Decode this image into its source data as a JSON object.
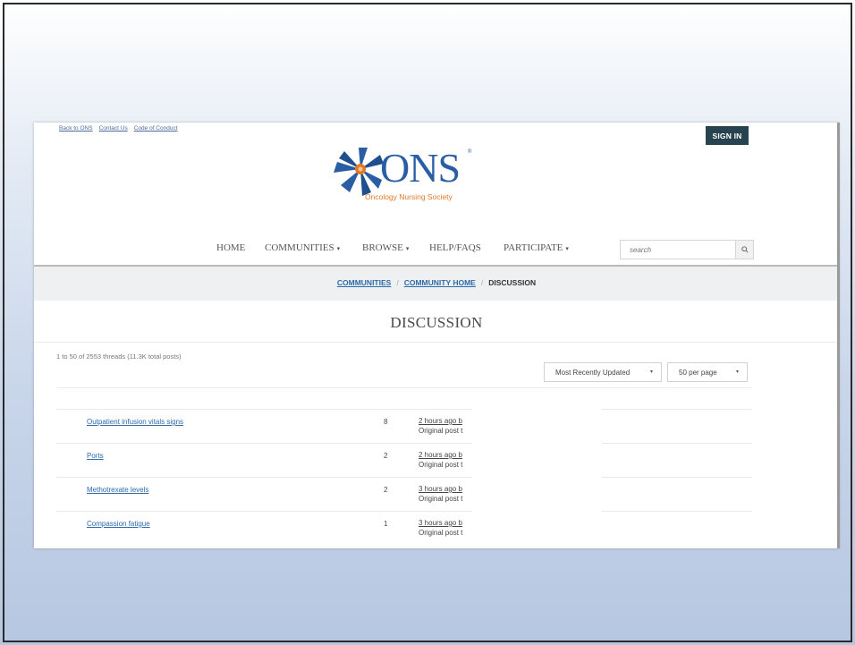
{
  "header": {
    "utility_links": [
      "Back to ONS",
      "Contact Us",
      "Code of Conduct"
    ],
    "sign_in_label": "SIGN IN"
  },
  "logo": {
    "name": "ONS",
    "registered": "®",
    "subtitle": "Oncology Nursing Society",
    "colors": {
      "primary": "#2a5ea4",
      "accent": "#e07a27"
    }
  },
  "nav": {
    "items": [
      {
        "label": "HOME",
        "has_dropdown": false
      },
      {
        "label": "COMMUNITIES",
        "has_dropdown": true
      },
      {
        "label": "BROWSE",
        "has_dropdown": true
      },
      {
        "label": "HELP/FAQS",
        "has_dropdown": false
      },
      {
        "label": "PARTICIPATE",
        "has_dropdown": true
      }
    ],
    "dropdown_caret": "▾",
    "search_placeholder": "search",
    "search_icon": "search-icon"
  },
  "breadcrumb": {
    "items": [
      "COMMUNITIES",
      "COMMUNITY HOME"
    ],
    "separator": "/",
    "current": "DISCUSSION"
  },
  "page": {
    "title": "DISCUSSION",
    "summary": "1 to 50 of 2553 threads (11.3K total posts)",
    "sort_selected": "Most Recently Updated",
    "per_page_selected": "50 per page"
  },
  "threads": [
    {
      "title": "Outpatient infusion vitals signs",
      "count": "8",
      "last_activity": "2 hours ago b",
      "original_post": "Original post t"
    },
    {
      "title": "Ports",
      "count": "2",
      "last_activity": "2 hours ago b",
      "original_post": "Original post t"
    },
    {
      "title": "Methotrexate levels",
      "count": "2",
      "last_activity": "3 hours ago b",
      "original_post": "Original post t"
    },
    {
      "title": "Compassion fatigue",
      "count": "1",
      "last_activity": "3 hours ago b",
      "original_post": "Original post t"
    }
  ],
  "colors": {
    "sign_in_bg": "#27434f",
    "link": "#2c6aa8",
    "breadcrumb_band": "#eff0f2"
  }
}
